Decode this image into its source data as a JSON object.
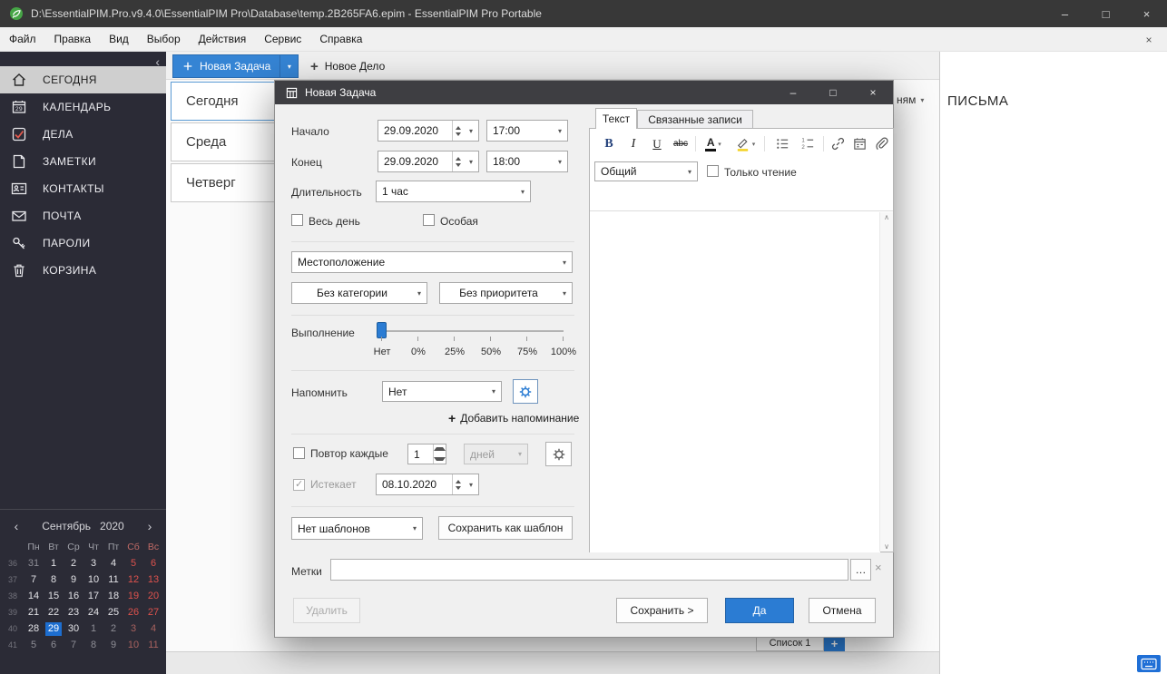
{
  "icons": {
    "minimize": "–",
    "maximize": "□",
    "close": "×",
    "caret_down": "▾",
    "chevron_left": "‹",
    "chevron_right": "›",
    "plus": "+",
    "ellipsis": "…",
    "scroll_up": "∧",
    "scroll_down": "∨",
    "clear": "×"
  },
  "titlebar": {
    "title": "D:\\EssentialPIM.Pro.v9.4.0\\EssentialPIM Pro\\Database\\temp.2B265FA6.epim - EssentialPIM Pro Portable"
  },
  "menubar": {
    "items": [
      "Файл",
      "Правка",
      "Вид",
      "Выбор",
      "Действия",
      "Сервис",
      "Справка"
    ]
  },
  "toolbar": {
    "new_task": "Новая Задача",
    "new_item": "Новое Дело"
  },
  "sidebar": {
    "items": [
      {
        "label": "СЕГОДНЯ"
      },
      {
        "label": "КАЛЕНДАРЬ"
      },
      {
        "label": "ДЕЛА"
      },
      {
        "label": "ЗАМЕТКИ"
      },
      {
        "label": "КОНТАКТЫ"
      },
      {
        "label": "ПОЧТА"
      },
      {
        "label": "ПАРОЛИ"
      },
      {
        "label": "КОРЗИНА"
      }
    ],
    "calendar_badge_day": "29",
    "mini_calendar": {
      "month": "Сентябрь",
      "year": "2020",
      "day_headers": [
        "Пн",
        "Вт",
        "Ср",
        "Чт",
        "Пт",
        "Сб",
        "Вс"
      ],
      "week_numbers": [
        "36",
        "37",
        "38",
        "39",
        "40",
        "41"
      ],
      "weeks": [
        [
          "31",
          "1",
          "2",
          "3",
          "4",
          "5",
          "6"
        ],
        [
          "7",
          "8",
          "9",
          "10",
          "11",
          "12",
          "13"
        ],
        [
          "14",
          "15",
          "16",
          "17",
          "18",
          "19",
          "20"
        ],
        [
          "21",
          "22",
          "23",
          "24",
          "25",
          "26",
          "27"
        ],
        [
          "28",
          "29",
          "30",
          "1",
          "2",
          "3",
          "4"
        ],
        [
          "5",
          "6",
          "7",
          "8",
          "9",
          "10",
          "11"
        ]
      ],
      "selected_day": "29"
    }
  },
  "today_view": {
    "cards": [
      "Сегодня",
      "Среда",
      "Четверг"
    ],
    "group_by_partial": "ням",
    "list_tab": "Список 1"
  },
  "mail_panel": {
    "title": "ПИСЬМА"
  },
  "dialog": {
    "title": "Новая Задача",
    "start_label": "Начало",
    "start_date": "29.09.2020",
    "start_time": "17:00",
    "end_label": "Конец",
    "end_date": "29.09.2020",
    "end_time": "18:00",
    "duration_label": "Длительность",
    "duration_value": "1 час",
    "all_day_label": "Весь день",
    "special_label": "Особая",
    "location_value": "Местоположение",
    "category_value": "Без категории",
    "priority_value": "Без приоритета",
    "completion_label": "Выполнение",
    "completion_ticks": [
      "Нет",
      "0%",
      "25%",
      "50%",
      "75%",
      "100%"
    ],
    "reminder_label": "Напомнить",
    "reminder_value": "Нет",
    "add_reminder_label": "Добавить напоминание",
    "repeat_label": "Повтор каждые",
    "repeat_value": "1",
    "repeat_unit": "дней",
    "expires_label": "Истекает",
    "expires_date": "08.10.2020",
    "templates_value": "Нет шаблонов",
    "save_template_label": "Сохранить как шаблон",
    "tags_label": "Метки",
    "editor": {
      "tab_text": "Текст",
      "tab_related": "Связанные записи",
      "bold": "B",
      "italic": "I",
      "underline": "U",
      "strikethrough": "abc",
      "font_color": "A",
      "style_value": "Общий",
      "readonly_label": "Только чтение"
    },
    "buttons": {
      "delete": "Удалить",
      "save": "Сохранить >",
      "yes": "Да",
      "cancel": "Отмена"
    }
  }
}
